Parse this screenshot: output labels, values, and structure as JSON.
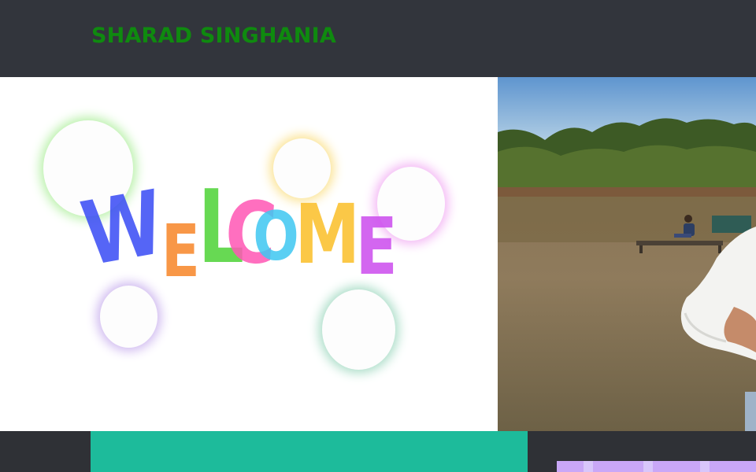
{
  "header": {
    "brand_name": "SHARAD SINGHANIA",
    "brand_color": "#0f8a0f",
    "background": "#32353c"
  },
  "hero": {
    "welcome_text": "WELCOME",
    "letters": [
      {
        "char": "W",
        "color": "#3a4cf5"
      },
      {
        "char": "E",
        "color": "#f7862a"
      },
      {
        "char": "L",
        "color": "#4fd337"
      },
      {
        "char": "C",
        "color": "#ff58b5"
      },
      {
        "char": "O",
        "color": "#3fc8f2"
      },
      {
        "char": "M",
        "color": "#fbbf2a"
      },
      {
        "char": "E",
        "color": "#cc4dee"
      }
    ],
    "bubble_glow_colors": [
      "#b6f0a6",
      "#fbe28f",
      "#f3b4f4",
      "#cdb6ef",
      "#a8dcc6"
    ],
    "photo_description_icon": "person-outdoor-photo-icon"
  },
  "footer": {
    "accent_teal": "#1dbb9b",
    "accent_lilac": "#c9a7f7",
    "background": "#2f3136"
  }
}
